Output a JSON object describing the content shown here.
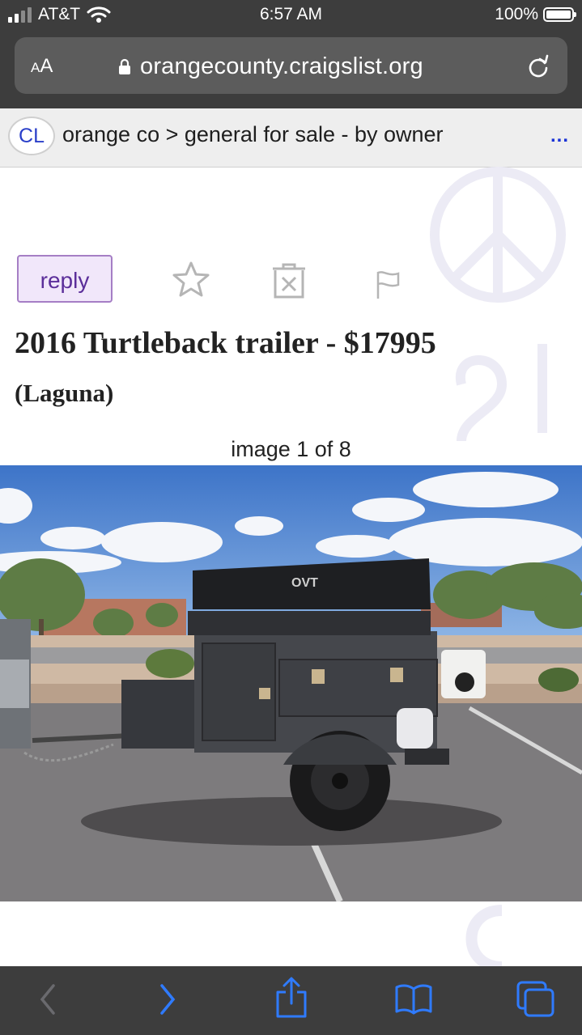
{
  "status_bar": {
    "carrier": "AT&T",
    "time": "6:57 AM",
    "battery": "100%"
  },
  "browser": {
    "text_size_label_small": "A",
    "text_size_label_large": "A",
    "url": "orangecounty.craigslist.org"
  },
  "breadcrumb": {
    "logo": "CL",
    "text": "orange co > general for sale - by owner",
    "more": "..."
  },
  "actions": {
    "reply_label": "reply"
  },
  "listing": {
    "title": "2016 Turtleback trailer - $17995",
    "location": "(Laguna)",
    "image_counter": "image 1 of 8"
  },
  "colors": {
    "chrome": "#3d3d3d",
    "link_blue": "#1a33d6",
    "reply_purple": "#5b2e9a",
    "toolbar_blue": "#2f7bff"
  }
}
